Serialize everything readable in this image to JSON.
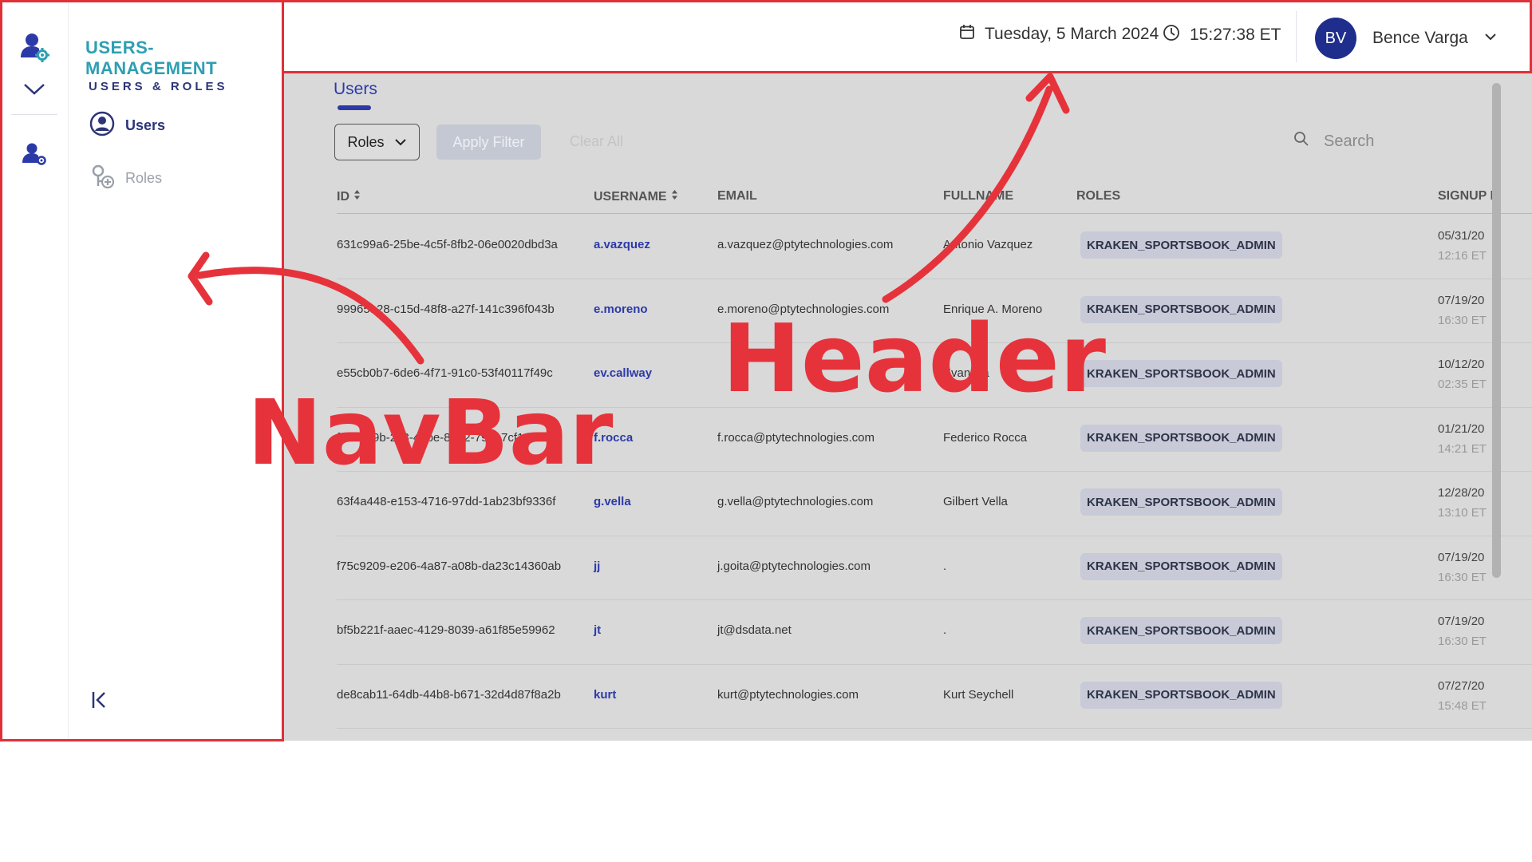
{
  "sidebar": {
    "app_title": "USERS-MANAGEMENT",
    "section_title": "USERS & ROLES",
    "items": [
      {
        "label": "Users",
        "active": true,
        "icon": "user-circle-icon"
      },
      {
        "label": "Roles",
        "active": false,
        "icon": "key-add-icon"
      }
    ]
  },
  "header": {
    "date": "Tuesday, 5 March 2024",
    "time": "15:27:38 ET",
    "user_initials": "BV",
    "user_name": "Bence Varga"
  },
  "main": {
    "tab": "Users",
    "filter": {
      "roles_label": "Roles",
      "apply_label": "Apply Filter",
      "clear_label": "Clear All",
      "search_placeholder": "Search"
    },
    "columns": [
      "ID",
      "USERNAME",
      "EMAIL",
      "FULLNAME",
      "ROLES",
      "SIGNUP D"
    ],
    "rows": [
      {
        "id": "631c99a6-25be-4c5f-8fb2-06e0020dbd3a",
        "username": "a.vazquez",
        "email": "a.vazquez@ptytechnologies.com",
        "fullname": "Antonio Vazquez",
        "role": "KRAKEN_SPORTSBOOK_ADMIN",
        "date": "05/31/20",
        "time": "12:16 ET"
      },
      {
        "id": "99965a28-c15d-48f8-a27f-141c396f043b",
        "username": "e.moreno",
        "email": "e.moreno@ptytechnologies.com",
        "fullname": "Enrique A. Moreno",
        "role": "KRAKEN_SPORTSBOOK_ADMIN",
        "date": "07/19/20",
        "time": "16:30 ET"
      },
      {
        "id": "e55cb0b7-6de6-4f71-91c0-53f40117f49c",
        "username": "ev.callway",
        "email": "",
        "fullname": "Evan Ca",
        "role": "KRAKEN_SPORTSBOOK_ADMIN",
        "date": "10/12/20",
        "time": "02:35 ET"
      },
      {
        "id": "f14ceb9b-2c3-48be-85e2-795b7cf1",
        "username": "f.rocca",
        "email": "f.rocca@ptytechnologies.com",
        "fullname": "Federico Rocca",
        "role": "KRAKEN_SPORTSBOOK_ADMIN",
        "date": "01/21/20",
        "time": "14:21 ET"
      },
      {
        "id": "63f4a448-e153-4716-97dd-1ab23bf9336f",
        "username": "g.vella",
        "email": "g.vella@ptytechnologies.com",
        "fullname": "Gilbert Vella",
        "role": "KRAKEN_SPORTSBOOK_ADMIN",
        "date": "12/28/20",
        "time": "13:10 ET"
      },
      {
        "id": "f75c9209-e206-4a87-a08b-da23c14360ab",
        "username": "jj",
        "email": "j.goita@ptytechnologies.com",
        "fullname": ".",
        "role": "KRAKEN_SPORTSBOOK_ADMIN",
        "date": "07/19/20",
        "time": "16:30 ET"
      },
      {
        "id": "bf5b221f-aaec-4129-8039-a61f85e59962",
        "username": "jt",
        "email": "jt@dsdata.net",
        "fullname": ".",
        "role": "KRAKEN_SPORTSBOOK_ADMIN",
        "date": "07/19/20",
        "time": "16:30 ET"
      },
      {
        "id": "de8cab11-64db-44b8-b671-32d4d87f8a2b",
        "username": "kurt",
        "email": "kurt@ptytechnologies.com",
        "fullname": "Kurt Seychell",
        "role": "KRAKEN_SPORTSBOOK_ADMIN",
        "date": "07/27/20",
        "time": "15:48 ET"
      }
    ]
  },
  "annotations": {
    "navbar_label": "NavBar",
    "header_label": "Header",
    "color": "#e6333b"
  }
}
